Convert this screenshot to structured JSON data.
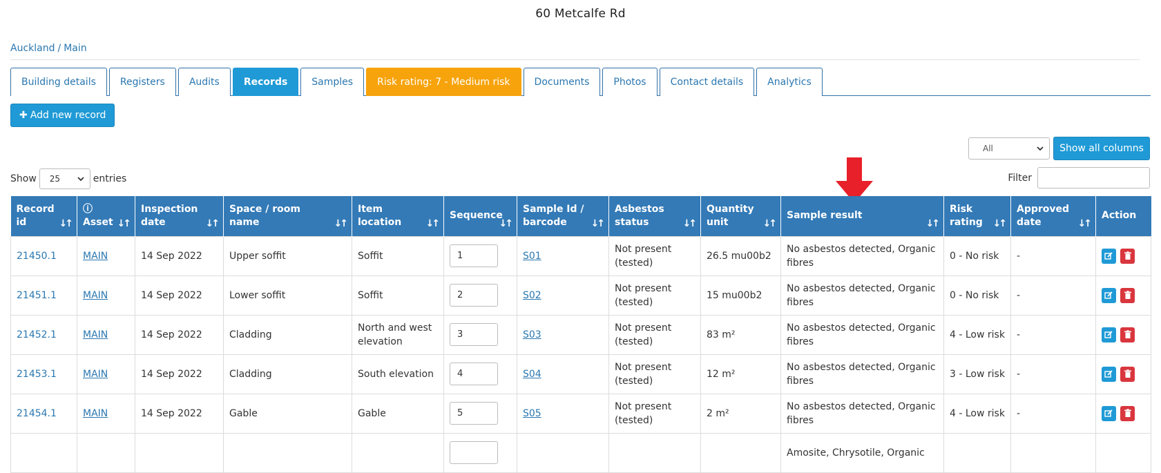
{
  "page": {
    "title": "60 Metcalfe Rd"
  },
  "breadcrumb": {
    "parts": [
      "Auckland",
      "Main"
    ],
    "separator": "/"
  },
  "tabs": [
    {
      "label": "Building details",
      "state": "normal"
    },
    {
      "label": "Registers",
      "state": "normal"
    },
    {
      "label": "Audits",
      "state": "normal"
    },
    {
      "label": "Records",
      "state": "active"
    },
    {
      "label": "Samples",
      "state": "normal"
    },
    {
      "label": "Risk rating: 7 - Medium risk",
      "state": "warning"
    },
    {
      "label": "Documents",
      "state": "normal"
    },
    {
      "label": "Photos",
      "state": "normal"
    },
    {
      "label": "Contact details",
      "state": "normal"
    },
    {
      "label": "Analytics",
      "state": "normal"
    }
  ],
  "toolbar": {
    "add_label": "Add new record",
    "add_icon": "plus-icon",
    "column_select_value": "All",
    "show_all_columns_label": "Show all columns"
  },
  "table_controls": {
    "show_label": "Show",
    "entries_value": "25",
    "entries_label": "entries",
    "filter_label": "Filter",
    "filter_value": ""
  },
  "table": {
    "columns": [
      {
        "key": "record_id",
        "label": "Record id"
      },
      {
        "key": "asset",
        "label": "Asset",
        "icon": "info-icon"
      },
      {
        "key": "inspection_date",
        "label": "Inspection date"
      },
      {
        "key": "space",
        "label": "Space / room name"
      },
      {
        "key": "location",
        "label": "Item location"
      },
      {
        "key": "sequence",
        "label": "Sequence"
      },
      {
        "key": "sample_id",
        "label": "Sample Id / barcode"
      },
      {
        "key": "asbestos_status",
        "label": "Asbestos status"
      },
      {
        "key": "quantity",
        "label": "Quantity unit"
      },
      {
        "key": "sample_result",
        "label": "Sample result"
      },
      {
        "key": "risk_rating",
        "label": "Risk rating"
      },
      {
        "key": "approved_date",
        "label": "Approved date"
      },
      {
        "key": "action",
        "label": "Action"
      }
    ],
    "rows": [
      {
        "record_id": "21450.1",
        "asset": "MAIN",
        "inspection_date": "14 Sep 2022",
        "space": "Upper soffit",
        "location": "Soffit",
        "sequence": "1",
        "sample_id": "S01",
        "asbestos_status": "Not present (tested)",
        "quantity": "26.5 mu00b2",
        "sample_result": "No asbestos detected, Organic fibres",
        "risk_rating": "0 - No risk",
        "approved_date": "-"
      },
      {
        "record_id": "21451.1",
        "asset": "MAIN",
        "inspection_date": "14 Sep 2022",
        "space": "Lower soffit",
        "location": "Soffit",
        "sequence": "2",
        "sample_id": "S02",
        "asbestos_status": "Not present (tested)",
        "quantity": "15 mu00b2",
        "sample_result": "No asbestos detected, Organic fibres",
        "risk_rating": "0 - No risk",
        "approved_date": "-"
      },
      {
        "record_id": "21452.1",
        "asset": "MAIN",
        "inspection_date": "14 Sep 2022",
        "space": "Cladding",
        "location": "North and west elevation",
        "sequence": "3",
        "sample_id": "S03",
        "asbestos_status": "Not present (tested)",
        "quantity": "83 m²",
        "sample_result": "No asbestos detected, Organic fibres",
        "risk_rating": "4 - Low risk",
        "approved_date": "-"
      },
      {
        "record_id": "21453.1",
        "asset": "MAIN",
        "inspection_date": "14 Sep 2022",
        "space": "Cladding",
        "location": "South elevation",
        "sequence": "4",
        "sample_id": "S04",
        "asbestos_status": "Not present (tested)",
        "quantity": "12 m²",
        "sample_result": "No asbestos detected, Organic fibres",
        "risk_rating": "3 - Low risk",
        "approved_date": "-"
      },
      {
        "record_id": "21454.1",
        "asset": "MAIN",
        "inspection_date": "14 Sep 2022",
        "space": "Gable",
        "location": "Gable",
        "sequence": "5",
        "sample_id": "S05",
        "asbestos_status": "Not present (tested)",
        "quantity": "2 m²",
        "sample_result": "No asbestos detected, Organic fibres",
        "risk_rating": "4 - Low risk",
        "approved_date": "-"
      },
      {
        "record_id": "",
        "asset": "",
        "inspection_date": "",
        "space": "",
        "location": "",
        "sequence": "",
        "sample_id": "",
        "asbestos_status": "",
        "quantity": "",
        "sample_result": "Amosite, Chrysotile, Organic",
        "risk_rating": "",
        "approved_date": ""
      }
    ],
    "row_actions": {
      "edit_icon": "edit-icon",
      "delete_icon": "trash-icon"
    }
  },
  "annotation": {
    "arrow_icon": "red-arrow-down-icon",
    "color": "#e8202a"
  },
  "colors": {
    "primary": "#1f9ad6",
    "header": "#337ab7",
    "warning": "#f7a30b",
    "danger": "#d9363e",
    "link": "#2a77b0"
  }
}
